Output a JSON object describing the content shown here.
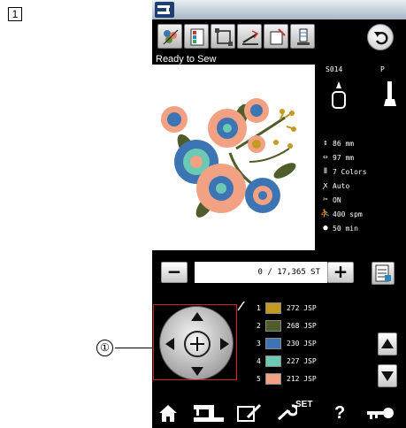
{
  "step_number": "1",
  "status": "Ready to Sew",
  "design_code": "S014",
  "presser_foot": "P",
  "info": {
    "height": "86 mm",
    "width": "97 mm",
    "colors": "7 Colors",
    "thread_cut_mode": "Auto",
    "thread_cut": "ON",
    "speed": "400 spm",
    "time": "50 min"
  },
  "counter": {
    "minus_label": "−",
    "plus_label": "+",
    "value": "0 / 17,365 ST"
  },
  "colors": [
    {
      "index": "1",
      "label": "272 JSP",
      "hex": "#c49a22"
    },
    {
      "index": "2",
      "label": "268 JSP",
      "hex": "#4f5d2a"
    },
    {
      "index": "3",
      "label": "230 JSP",
      "hex": "#3d74b3"
    },
    {
      "index": "4",
      "label": "227 JSP",
      "hex": "#6cc9b4"
    },
    {
      "index": "5",
      "label": "212 JSP",
      "hex": "#f2a183"
    }
  ],
  "callout": {
    "label": "①"
  },
  "bottom": {
    "set_label": "SET",
    "help_label": "?"
  },
  "accent": {
    "callout_color": "#d61f26"
  }
}
